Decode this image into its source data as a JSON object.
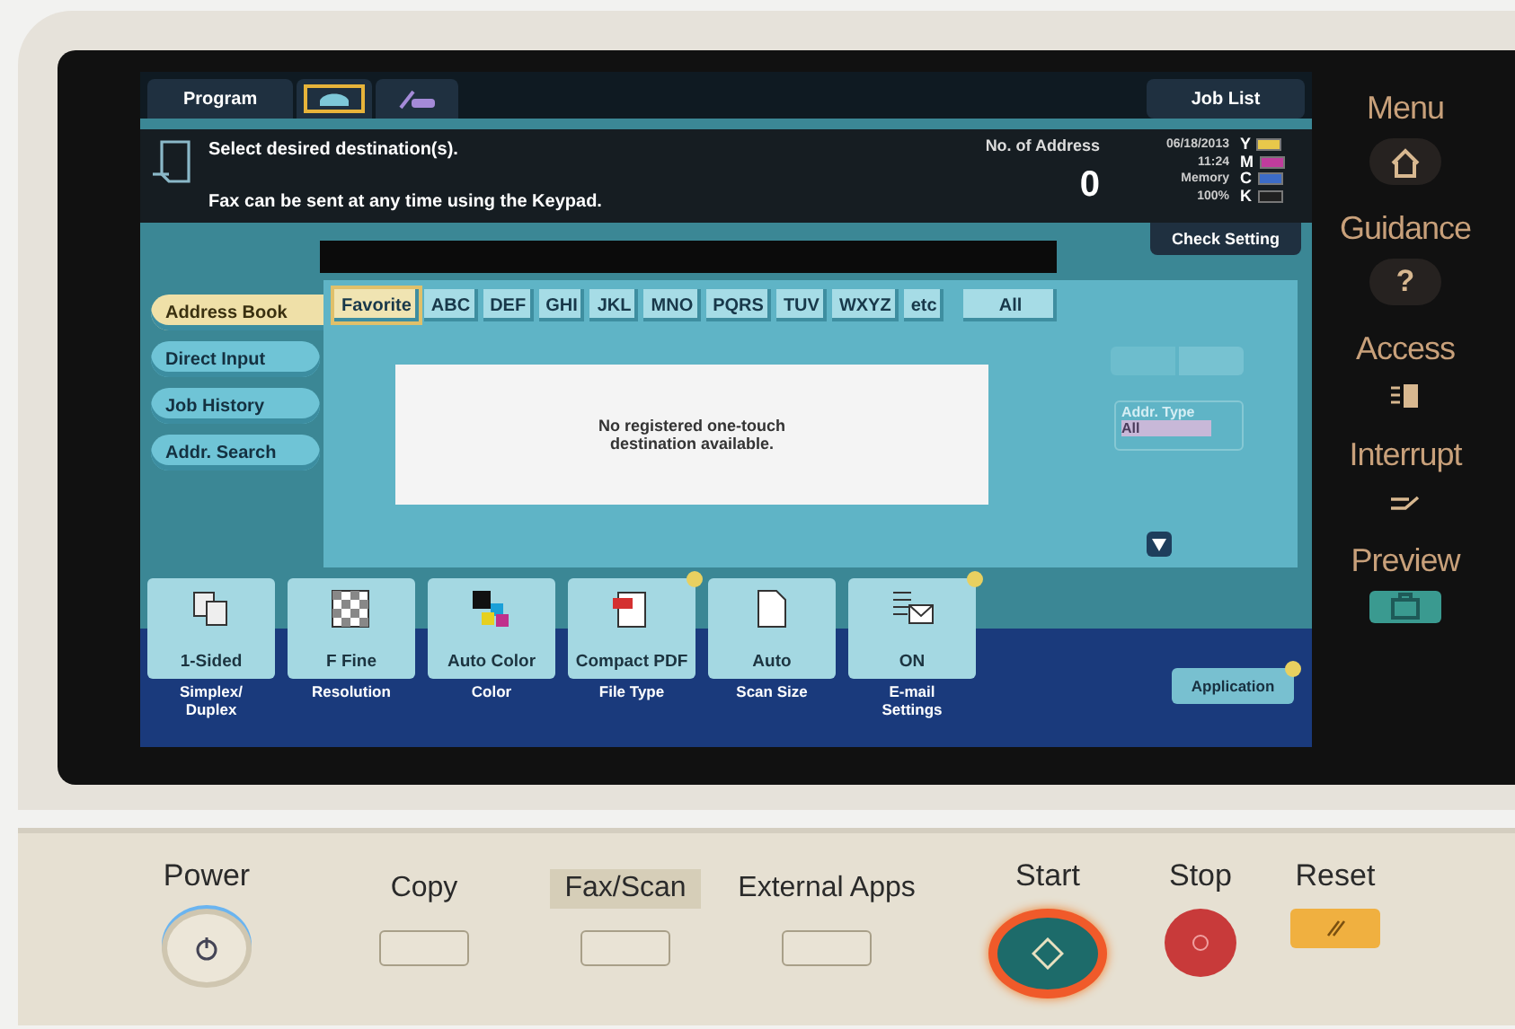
{
  "top_tabs": [
    {
      "kind": "text",
      "label": "Program",
      "selected": false
    },
    {
      "kind": "phone",
      "selected": true
    },
    {
      "kind": "line",
      "selected": false
    }
  ],
  "job_list": "Job List",
  "messages": [
    "Select desired destination(s).",
    "Fax can be sent at any time using the Keypad."
  ],
  "address_count": {
    "label": "No. of Address",
    "value": "0"
  },
  "status": {
    "date": "06/18/2013",
    "time": "11:24",
    "memory_label": "Memory",
    "memory": "100%"
  },
  "toner": [
    {
      "label": "Y",
      "color": "#e8c84a"
    },
    {
      "label": "M",
      "color": "#c03c9c"
    },
    {
      "label": "C",
      "color": "#3c6cc8"
    },
    {
      "label": "K",
      "color": "#202020"
    }
  ],
  "check_setting": "Check Setting",
  "side_tabs": [
    {
      "label": "Address Book",
      "selected": true
    },
    {
      "label": "Direct Input",
      "selected": false
    },
    {
      "label": "Job History",
      "selected": false
    },
    {
      "label": "Addr. Search",
      "selected": false
    }
  ],
  "index_tabs": [
    {
      "label": "Favorite",
      "selected": true
    },
    {
      "label": "ABC",
      "selected": false
    },
    {
      "label": "DEF",
      "selected": false
    },
    {
      "label": "GHI",
      "selected": false
    },
    {
      "label": "JKL",
      "selected": false
    },
    {
      "label": "MNO",
      "selected": false
    },
    {
      "label": "PQRS",
      "selected": false
    },
    {
      "label": "TUV",
      "selected": false
    },
    {
      "label": "WXYZ",
      "selected": false
    },
    {
      "label": "etc",
      "selected": false
    },
    {
      "label": "All",
      "selected": false
    }
  ],
  "empty_message": "No registered one-touch destination available.",
  "view_toggle": {
    "disabled": true
  },
  "addr_type": {
    "label": "Addr. Type",
    "value": "All",
    "disabled": true
  },
  "functions": [
    {
      "kind": "duplex",
      "value": "1-Sided",
      "label": "Simplex/ Duplex",
      "flag": false
    },
    {
      "kind": "resolution",
      "value": "F Fine",
      "label": "Resolution",
      "flag": false
    },
    {
      "kind": "color",
      "value": "Auto Color",
      "label": "Color",
      "flag": false
    },
    {
      "kind": "pdf",
      "value": "Compact PDF",
      "label": "File Type",
      "flag": true
    },
    {
      "kind": "page",
      "value": "Auto",
      "label": "Scan Size",
      "flag": false
    },
    {
      "kind": "email",
      "value": "ON",
      "label": "E-mail Settings",
      "flag": true
    }
  ],
  "application": {
    "label": "Application",
    "flag": true
  },
  "hard_keys": [
    {
      "label": "Menu",
      "kind": "home"
    },
    {
      "label": "Guidance",
      "kind": "help",
      "symbol": "?"
    },
    {
      "label": "Access",
      "kind": "access"
    },
    {
      "label": "Interrupt",
      "kind": "interrupt"
    },
    {
      "label": "Preview",
      "kind": "preview"
    }
  ],
  "power": "Power",
  "mode_keys": [
    {
      "label": "Copy",
      "selected": false
    },
    {
      "label": "Fax/Scan",
      "selected": true
    },
    {
      "label": "External Apps",
      "selected": false
    }
  ],
  "start": "Start",
  "stop": "Stop",
  "reset": "Reset"
}
